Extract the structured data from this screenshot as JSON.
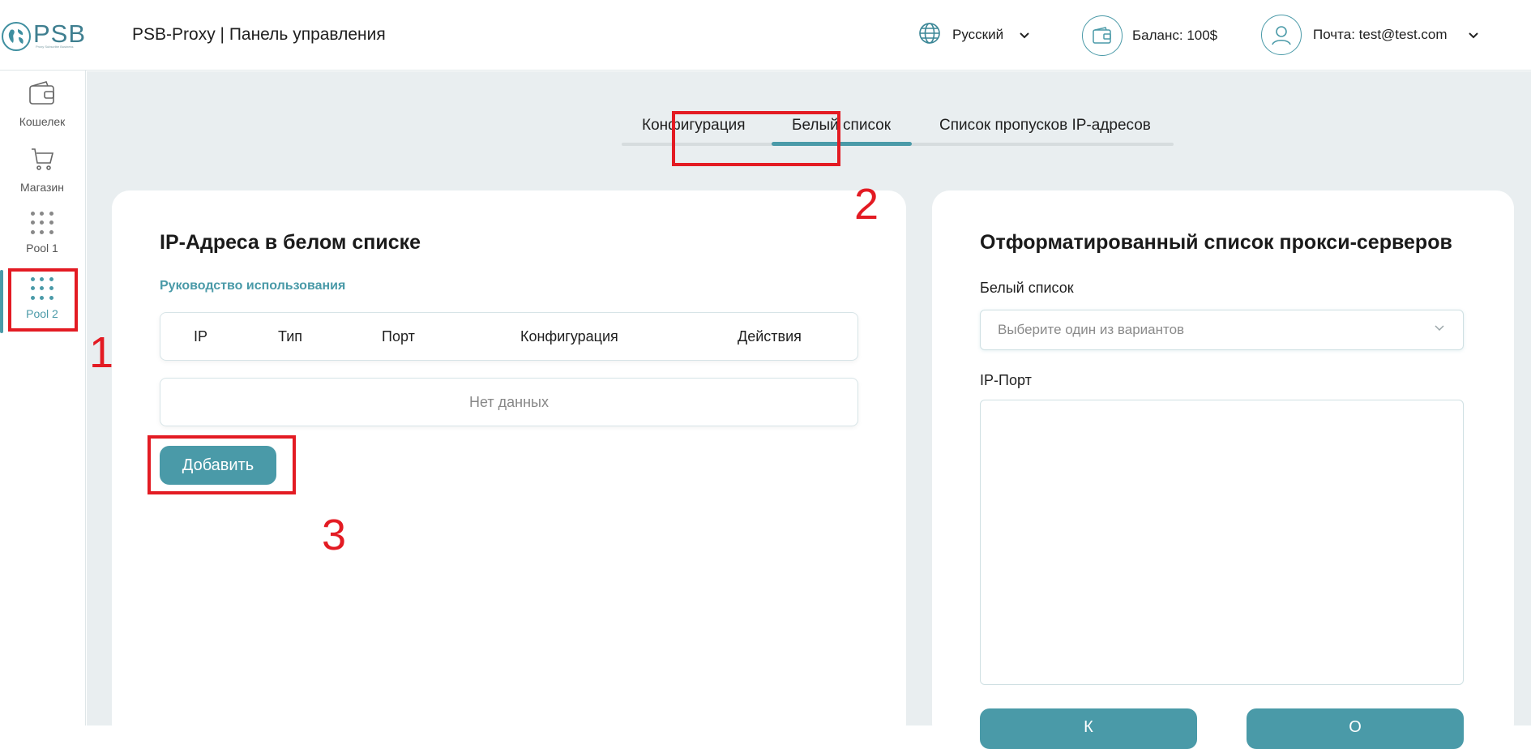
{
  "header": {
    "logo_text": "PSB",
    "logo_tagline": "Proxy Subscribe Business",
    "app_title": "PSB-Proxy | Панель управления",
    "language_label": "Русский",
    "balance_label": "Баланс: 100$",
    "email_label": "Почта: test@test.com"
  },
  "sidebar": {
    "items": [
      {
        "label": "Кошелек",
        "icon": "wallet-icon"
      },
      {
        "label": "Магазин",
        "icon": "cart-icon"
      },
      {
        "label": "Pool 1",
        "icon": "grid-dots-icon"
      },
      {
        "label": "Pool 2",
        "icon": "grid-dots-icon",
        "active": true
      }
    ]
  },
  "tabs": [
    {
      "label": "Конфигурация"
    },
    {
      "label": "Белый список",
      "active": true
    },
    {
      "label": "Список пропусков IP-адресов"
    }
  ],
  "left_card": {
    "title": "IP-Адреса в белом списке",
    "guide_link": "Руководство использования",
    "columns": [
      "IP",
      "Тип",
      "Порт",
      "Конфигурация",
      "Действия"
    ],
    "empty_text": "Нет данных",
    "add_button": "Добавить"
  },
  "right_card": {
    "title": "Отформатированный список прокси-серверов",
    "whitelist_label": "Белый список",
    "whitelist_placeholder": "Выберите один из вариантов",
    "ipport_label": "IP-Порт",
    "ipport_value": "",
    "button_left_partial": "К",
    "button_right_partial": "О"
  },
  "annotations": {
    "label_1": "1",
    "label_2": "2",
    "label_3": "3",
    "color": "#e31b23"
  },
  "colors": {
    "accent": "#4a9aa8",
    "background": "#e9eef0"
  }
}
